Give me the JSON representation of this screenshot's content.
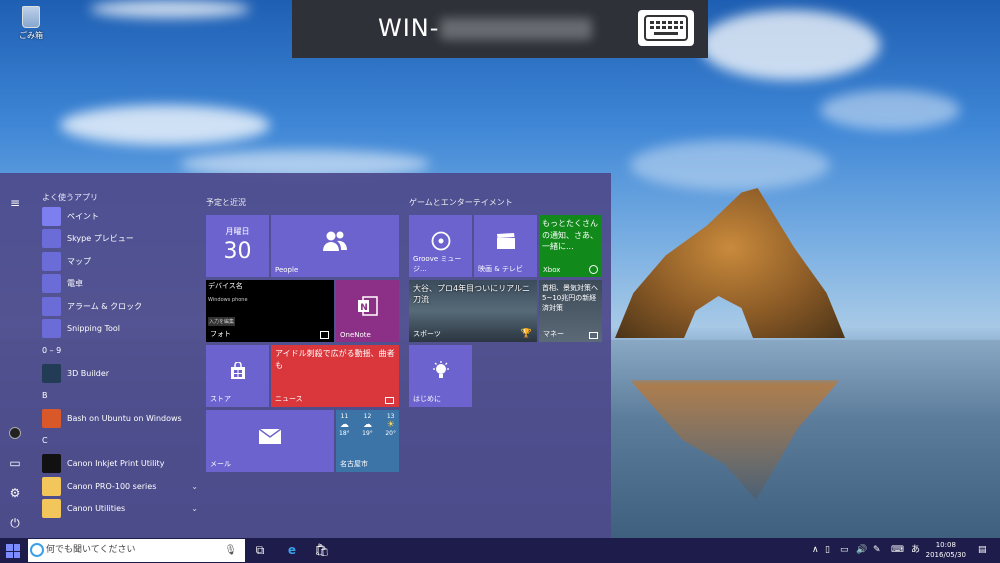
{
  "desktop": {
    "recycle_bin_label": "ごみ箱"
  },
  "remote_bar": {
    "title": "WIN-",
    "keyboard_icon": "keyboard-icon"
  },
  "start_menu": {
    "most_used_header": "よく使うアプリ",
    "most_used": [
      {
        "label": "ペイント",
        "icon": "paint-icon",
        "color": "#7d7ef0"
      },
      {
        "label": "Skype プレビュー",
        "icon": "skype-icon",
        "color": "#6c6cd8"
      },
      {
        "label": "マップ",
        "icon": "map-icon",
        "color": "#6c6cd8"
      },
      {
        "label": "電卓",
        "icon": "calculator-icon",
        "color": "#6c6cd8"
      },
      {
        "label": "アラーム & クロック",
        "icon": "alarm-icon",
        "color": "#6c6cd8"
      },
      {
        "label": "Snipping Tool",
        "icon": "scissors-icon",
        "color": "#6c6cd8"
      }
    ],
    "sections": [
      {
        "letter": "0 – 9",
        "apps": [
          {
            "label": "3D Builder",
            "icon": "3d-builder-icon",
            "color": "#233c55",
            "chevron": ""
          }
        ]
      },
      {
        "letter": "B",
        "apps": [
          {
            "label": "Bash on Ubuntu on Windows",
            "icon": "ubuntu-icon",
            "color": "#d9582a",
            "chevron": ""
          }
        ]
      },
      {
        "letter": "C",
        "apps": [
          {
            "label": "Canon Inkjet Print Utility",
            "icon": "printer-icon",
            "color": "#111111",
            "chevron": ""
          },
          {
            "label": "Canon PRO-100 series",
            "icon": "folder-icon",
            "color": "#f2c65a",
            "chevron": "⌄"
          },
          {
            "label": "Canon Utilities",
            "icon": "folder-icon",
            "color": "#f2c65a",
            "chevron": "⌄"
          }
        ]
      }
    ],
    "tiles": {
      "group1_header": "予定と近況",
      "group2_header": "ゲームとエンターテイメント",
      "calendar": {
        "weekday": "月曜日",
        "day": "30"
      },
      "people": {
        "label": "People"
      },
      "photos": {
        "label": "フォト",
        "caption1": "デバイス名",
        "caption2": "Windows phone",
        "caption3": "入力を編集"
      },
      "onenote": {
        "label": "OneNote"
      },
      "store": {
        "label": "ストア"
      },
      "news": {
        "label": "ニュース",
        "headline": "アイドル刺殺で広がる動揺、曲者も"
      },
      "mail": {
        "label": "メール"
      },
      "weather": {
        "label": "名古屋市",
        "days": [
          {
            "day": "11",
            "hi": "18°"
          },
          {
            "day": "12",
            "hi": "19°"
          },
          {
            "day": "13",
            "hi": "20°"
          }
        ]
      },
      "groove": {
        "label": "Groove ミュージ..."
      },
      "movies": {
        "label": "映画 & テレビ"
      },
      "xbox": {
        "label": "Xbox",
        "text": "もっとたくさんの通知、さあ、一緒に..."
      },
      "sports": {
        "label": "スポーツ",
        "headline": "大谷、プロ4年目ついにリアルニ刀流"
      },
      "money": {
        "label": "マネー",
        "headline": "首相、景気対策へ5~10兆円の新経済対策"
      },
      "tips": {
        "label": "はじめに"
      }
    }
  },
  "taskbar": {
    "search_placeholder": "何でも聞いてください",
    "ime": "あ",
    "time": "10:08",
    "date": "2016/05/30"
  },
  "colors": {
    "accent": "#6c63cf",
    "start_bg": "#4e4a8c",
    "news_red": "#d9373c",
    "xbox_green": "#118a1b",
    "taskbar": "#1e1c4a"
  }
}
